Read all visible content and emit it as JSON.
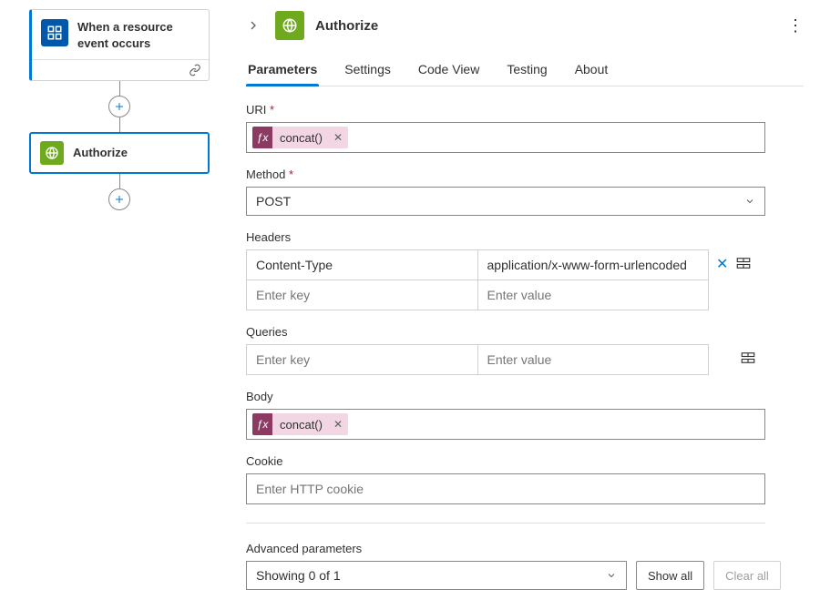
{
  "canvas": {
    "nodes": [
      {
        "title": "When a resource event occurs",
        "icon": "grid-icon",
        "accent": "#0058ad",
        "kind": "trigger"
      },
      {
        "title": "Authorize",
        "icon": "globe-icon",
        "accent": "#6fa91e",
        "kind": "action",
        "selected": true
      }
    ]
  },
  "panel": {
    "title": "Authorize",
    "tabs": [
      "Parameters",
      "Settings",
      "Code View",
      "Testing",
      "About"
    ],
    "active_tab": 0,
    "fields": {
      "uri": {
        "label": "URI",
        "required": true,
        "token": "concat()"
      },
      "method": {
        "label": "Method",
        "required": true,
        "value": "POST"
      },
      "headers": {
        "label": "Headers",
        "rows": [
          {
            "key": "Content-Type",
            "value": "application/x-www-form-urlencoded"
          }
        ],
        "placeholder_key": "Enter key",
        "placeholder_value": "Enter value"
      },
      "queries": {
        "label": "Queries",
        "placeholder_key": "Enter key",
        "placeholder_value": "Enter value"
      },
      "body": {
        "label": "Body",
        "token": "concat()"
      },
      "cookie": {
        "label": "Cookie",
        "placeholder": "Enter HTTP cookie"
      }
    },
    "advanced": {
      "label": "Advanced parameters",
      "summary": "Showing 0 of 1",
      "show_all": "Show all",
      "clear_all": "Clear all"
    }
  }
}
